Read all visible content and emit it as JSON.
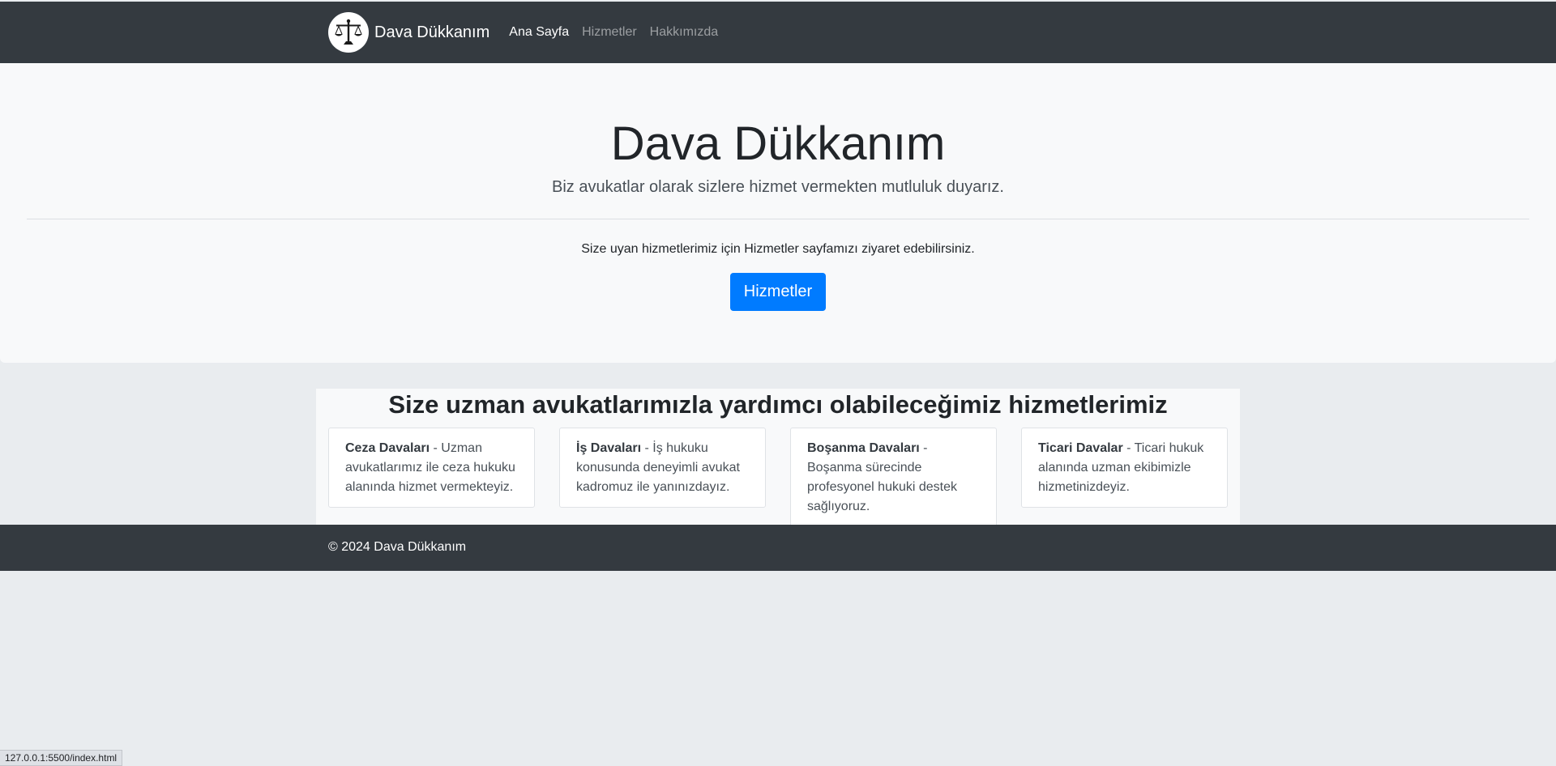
{
  "navbar": {
    "brand_name": "Dava Dükkanım",
    "logo_icon": "scales-of-justice-icon",
    "links": [
      {
        "label": "Ana Sayfa",
        "active": true
      },
      {
        "label": "Hizmetler",
        "active": false
      },
      {
        "label": "Hakkımızda",
        "active": false
      }
    ]
  },
  "hero": {
    "title": "Dava Dükkanım",
    "lead": "Biz avukatlar olarak sizlere hizmet vermekten mutluluk duyarız.",
    "text": "Size uyan hizmetlerimiz için Hizmetler sayfamızı ziyaret edebilirsiniz.",
    "button_label": "Hizmetler"
  },
  "services": {
    "title": "Size uzman avukatlarımızla yardımcı olabileceğimiz hizmetlerimiz",
    "cards": [
      {
        "name": "Ceza Davaları",
        "description": " - Uzman avukatlarımız ile ceza hukuku alanında hizmet vermekteyiz."
      },
      {
        "name": "İş Davaları",
        "description": " - İş hukuku konusunda deneyimli avukat kadromuz ile yanınızdayız."
      },
      {
        "name": "Boşanma Davaları",
        "description": " - Boşanma sürecinde profesyonel hukuki destek sağlıyoruz."
      },
      {
        "name": "Ticari Davalar",
        "description": " - Ticari hukuk alanında uzman ekibimizle hizmetinizdeyiz."
      }
    ]
  },
  "footer": {
    "text": "© 2024 Dava Dükkanım"
  },
  "status_bar": {
    "url": "127.0.0.1:5500/index.html"
  },
  "colors": {
    "navbar_bg": "#343a40",
    "primary": "#007bff",
    "hero_bg": "#f8f9fa",
    "page_bg": "#e9ecef"
  }
}
